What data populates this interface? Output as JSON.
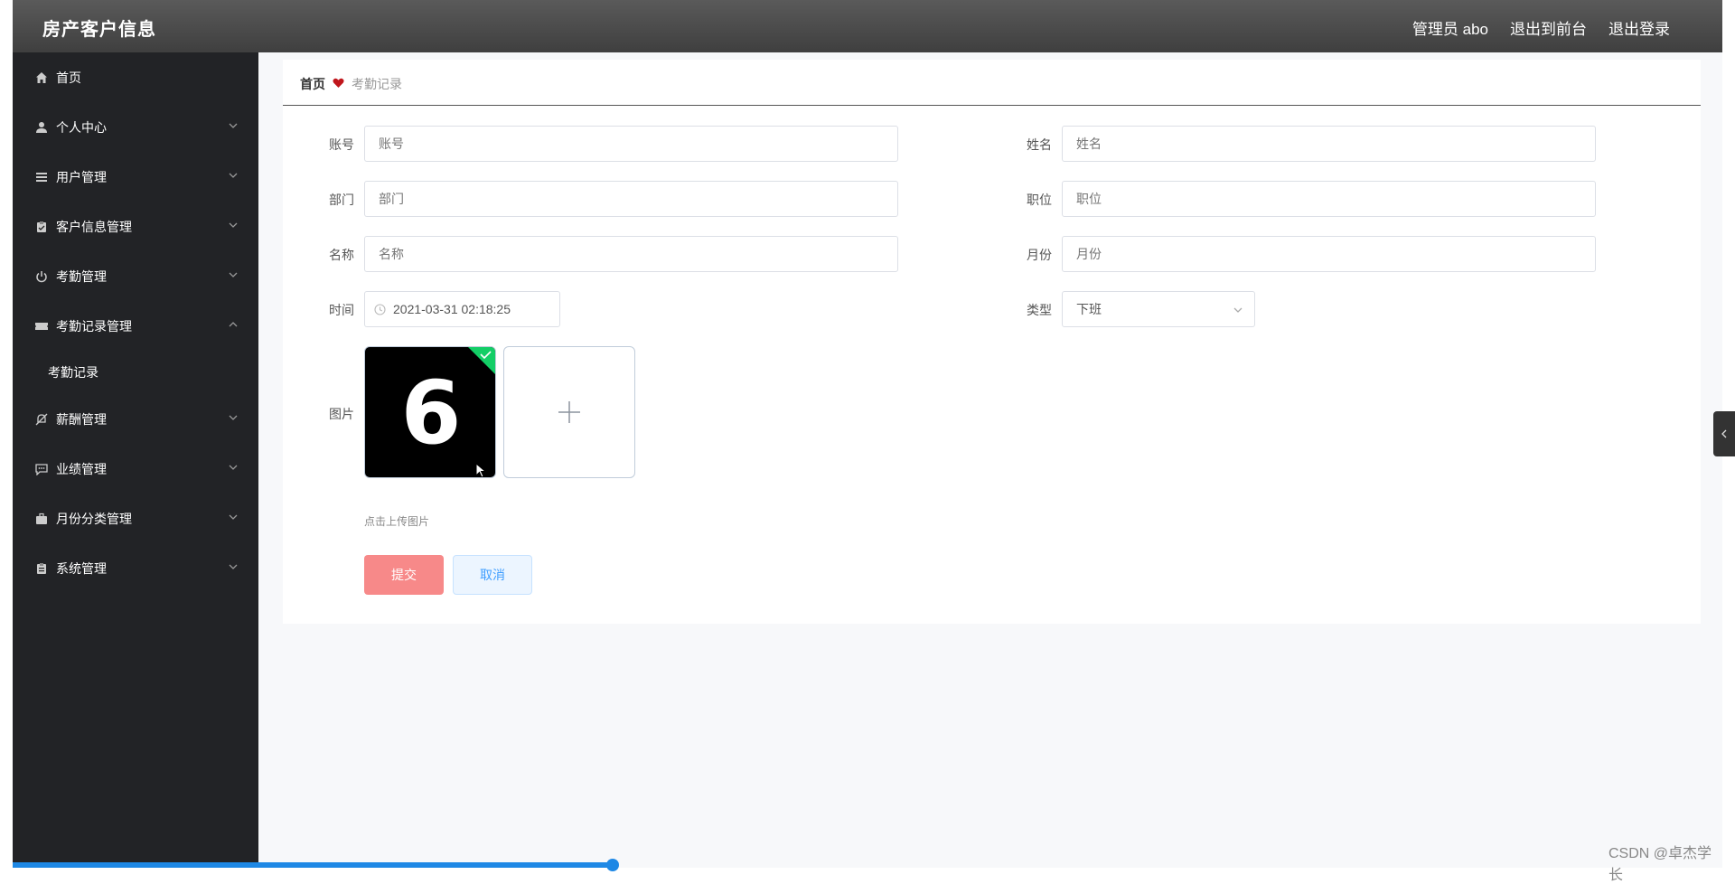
{
  "app": {
    "title": "房产客户信息"
  },
  "topbar": {
    "admin": "管理员 abo",
    "front": "退出到前台",
    "logout": "退出登录"
  },
  "sidebar": {
    "items": [
      {
        "label": "首页",
        "icon": "home-icon"
      },
      {
        "label": "个人中心",
        "icon": "user-icon"
      },
      {
        "label": "用户管理",
        "icon": "list-icon"
      },
      {
        "label": "客户信息管理",
        "icon": "clipboard-icon"
      },
      {
        "label": "考勤管理",
        "icon": "power-icon"
      },
      {
        "label": "考勤记录管理",
        "icon": "ticket-icon",
        "expanded": true,
        "children": [
          {
            "label": "考勤记录"
          }
        ]
      },
      {
        "label": "薪酬管理",
        "icon": "bell-off-icon"
      },
      {
        "label": "业绩管理",
        "icon": "message-icon"
      },
      {
        "label": "月份分类管理",
        "icon": "briefcase-icon"
      },
      {
        "label": "系统管理",
        "icon": "clipboard-icon"
      }
    ]
  },
  "breadcrumb": {
    "home": "首页",
    "current": "考勤记录"
  },
  "form": {
    "account": {
      "label": "账号",
      "placeholder": "账号"
    },
    "name": {
      "label": "姓名",
      "placeholder": "姓名"
    },
    "dept": {
      "label": "部门",
      "placeholder": "部门"
    },
    "position": {
      "label": "职位",
      "placeholder": "职位"
    },
    "title": {
      "label": "名称",
      "placeholder": "名称"
    },
    "month": {
      "label": "月份",
      "placeholder": "月份"
    },
    "time": {
      "label": "时间",
      "value": "2021-03-31 02:18:25"
    },
    "type": {
      "label": "类型",
      "value": "下班"
    },
    "image": {
      "label": "图片",
      "thumb_text": "6",
      "tip": "点击上传图片"
    },
    "submit": "提交",
    "cancel": "取消"
  },
  "watermark": "CSDN @卓杰学长",
  "colors": {
    "accent": "#409eff",
    "submit": "#f78989",
    "sidebar": "#222326",
    "topbar": "#4a4a4a",
    "success": "#13ce66"
  }
}
